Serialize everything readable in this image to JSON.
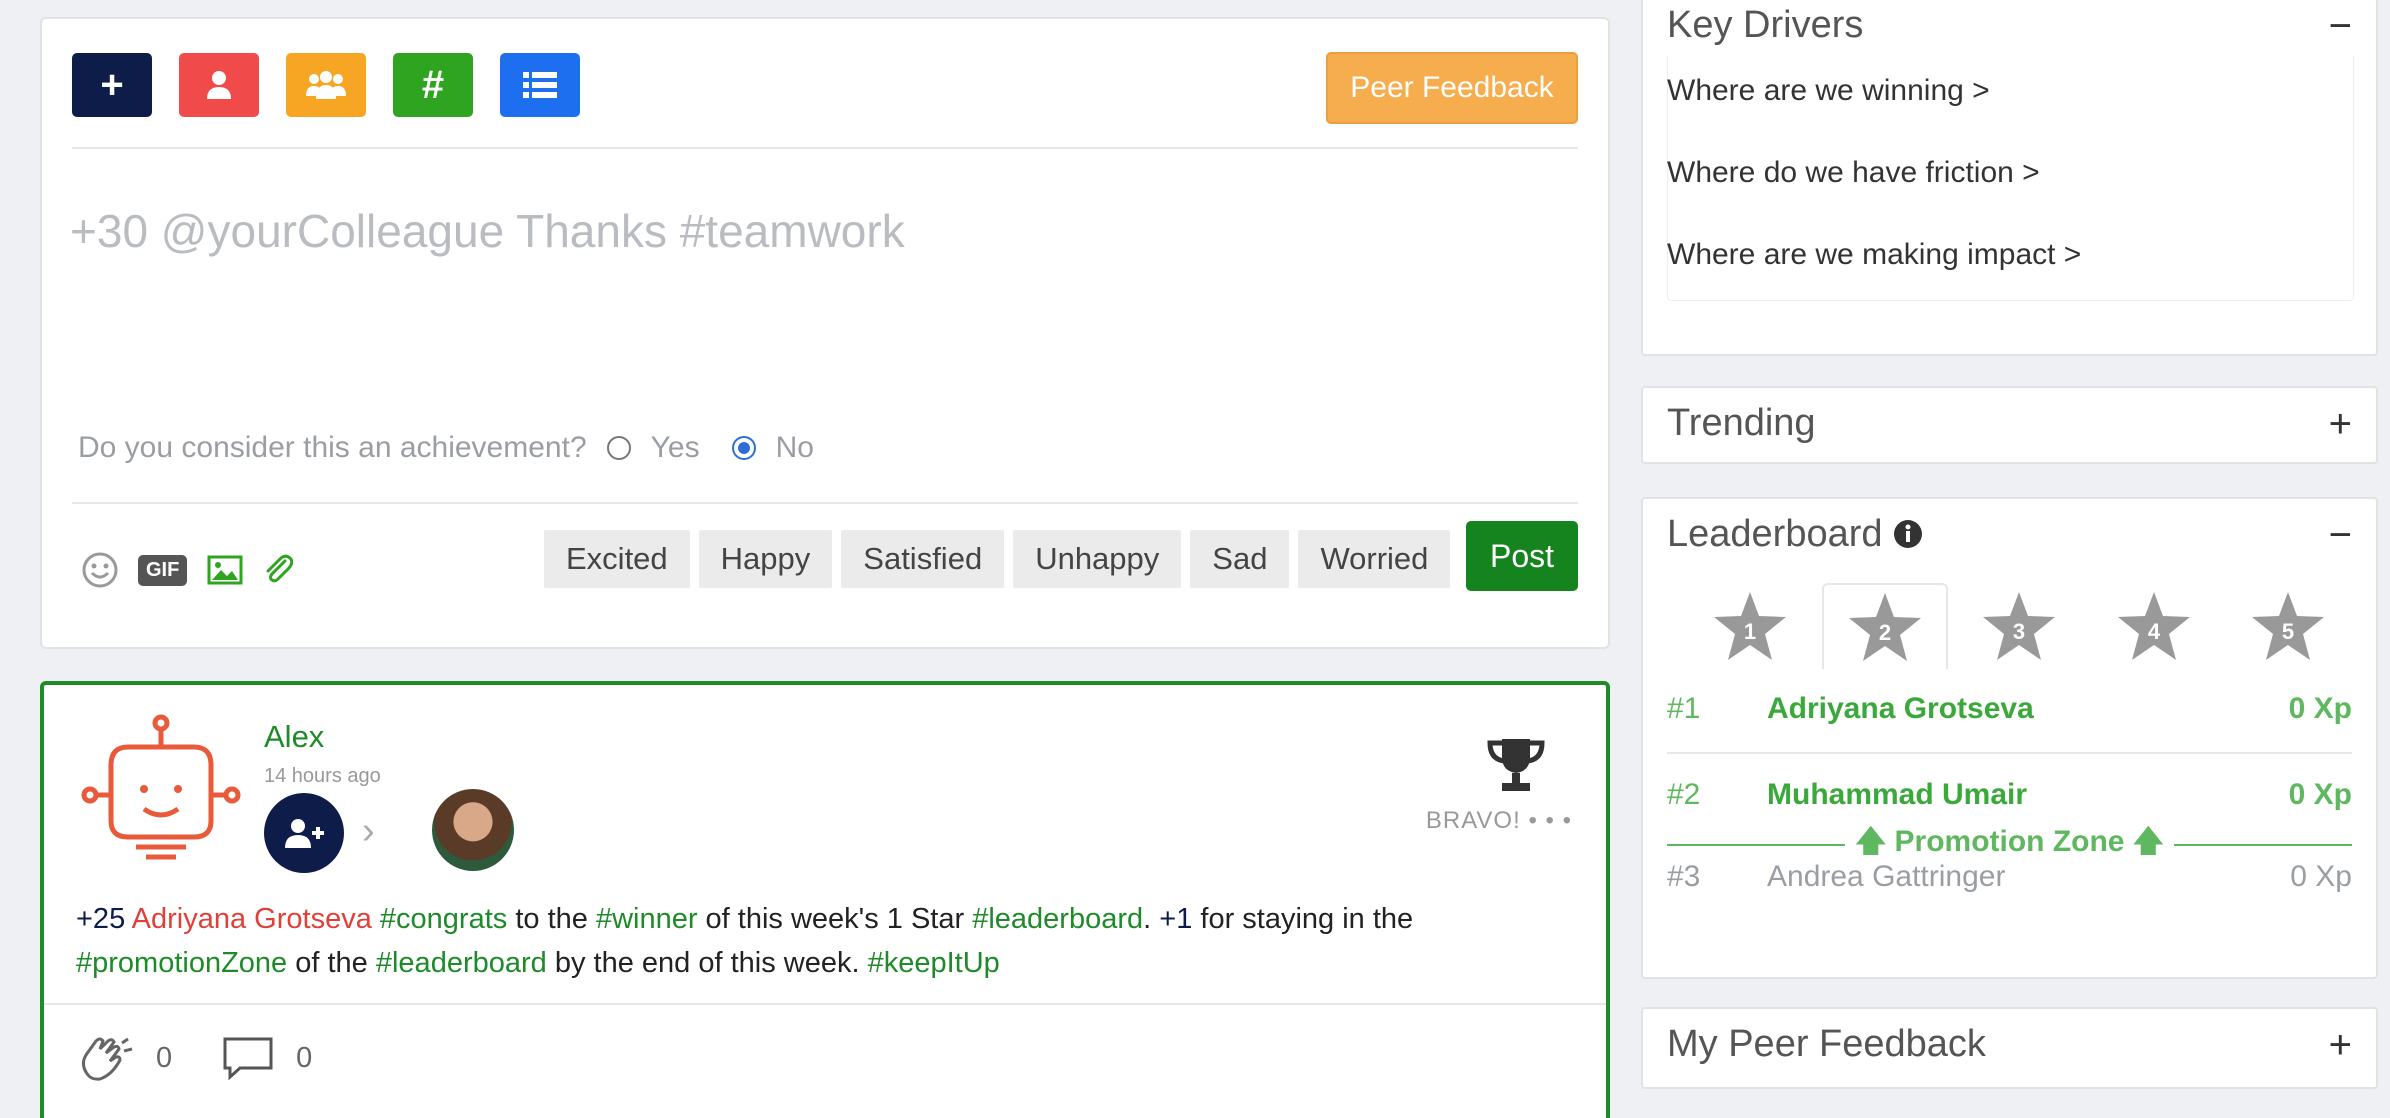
{
  "composer": {
    "toolbar": [
      {
        "name": "add-button",
        "glyph": "+",
        "color": "#0e1c4a"
      },
      {
        "name": "user-button",
        "glyph": "👤",
        "color": "#f04a4a"
      },
      {
        "name": "team-button",
        "glyph": "👥",
        "color": "#f6a623"
      },
      {
        "name": "hashtag-button",
        "glyph": "#",
        "color": "#2ea421"
      },
      {
        "name": "list-button",
        "glyph": "☰",
        "color": "#1e6ff0"
      }
    ],
    "peer_feedback_label": "Peer Feedback",
    "placeholder": "+30 @yourColleague Thanks #teamwork",
    "achievement_question": "Do you consider this an achievement?",
    "yes_label": "Yes",
    "no_label": "No",
    "selected_achievement": "No",
    "gif_label": "GIF",
    "moods": [
      "Excited",
      "Happy",
      "Satisfied",
      "Unhappy",
      "Sad",
      "Worried"
    ],
    "post_label": "Post"
  },
  "feed": {
    "author": "Alex",
    "time": "14 hours ago",
    "bravo_label": "BRAVO!",
    "more_label": "• • •",
    "text": {
      "p1": "+25",
      "name": "Adriyana Grotseva",
      "t1": "#congrats",
      "s1": " to the ",
      "t2": "#winner",
      "s2": " of this week's 1 Star ",
      "t3": "#leaderboard",
      "s3": ". ",
      "p2": "+1",
      "s4": " for staying in the ",
      "t4": "#promotionZone",
      "s5": " of the ",
      "t5": "#leaderboard",
      "s6": " by the end of this week. ",
      "t6": "#keepItUp"
    },
    "claps": "0",
    "comments": "0"
  },
  "key_drivers": {
    "title": "Key Drivers",
    "toggle": "−",
    "links": [
      "Where are we winning >",
      "Where do we have friction >",
      "Where are we making impact >"
    ]
  },
  "trending": {
    "title": "Trending",
    "toggle": "+"
  },
  "leaderboard": {
    "title": "Leaderboard",
    "toggle": "−",
    "stars": [
      "1",
      "2",
      "3",
      "4",
      "5"
    ],
    "selected_star": "2",
    "rows": [
      {
        "rank": "#1",
        "name": "Adriyana Grotseva",
        "xp": "0 Xp"
      },
      {
        "rank": "#2",
        "name": "Muhammad Umair",
        "xp": "0 Xp"
      },
      {
        "rank": "#3",
        "name": "Andrea Gattringer",
        "xp": "0 Xp"
      }
    ],
    "promotion_label": "🡅 Promotion Zone 🡅"
  },
  "my_peer_feedback": {
    "title": "My Peer Feedback",
    "toggle": "+"
  }
}
